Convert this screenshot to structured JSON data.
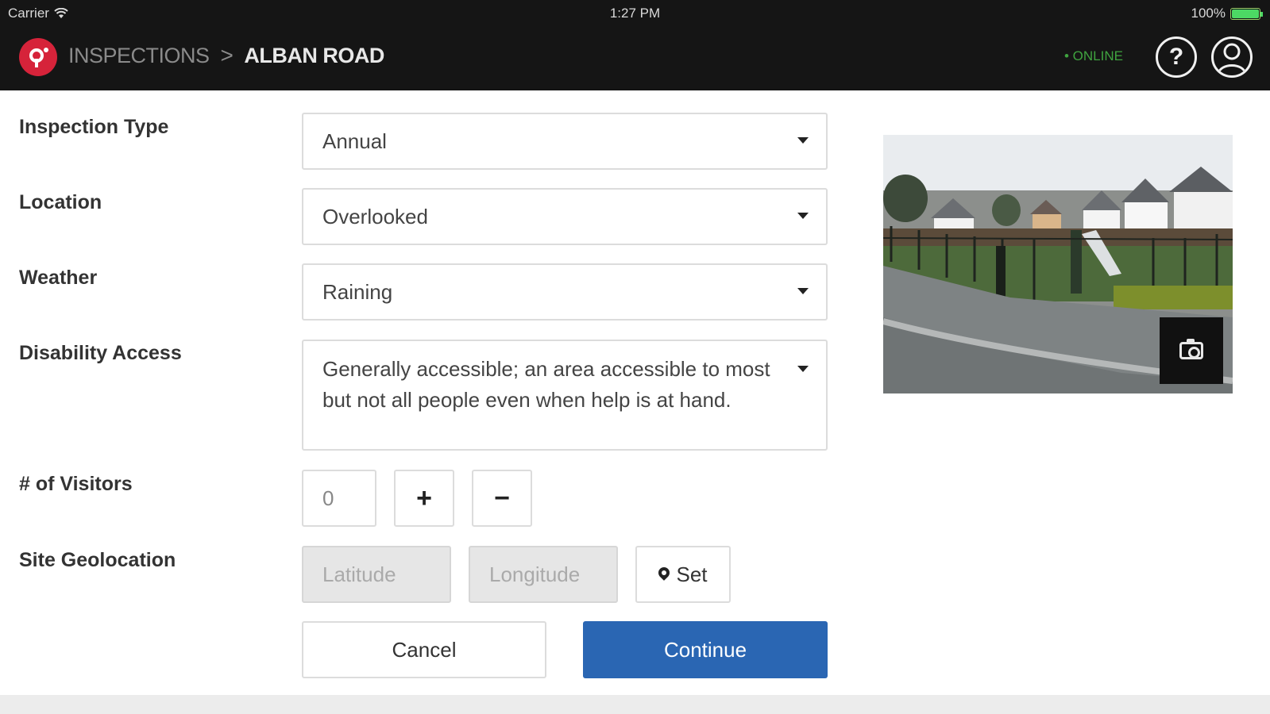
{
  "status_bar": {
    "carrier": "Carrier",
    "time": "1:27 PM",
    "battery": "100%"
  },
  "nav": {
    "breadcrumb_parent": "INSPECTIONS",
    "breadcrumb_sep": ">",
    "breadcrumb_current": "ALBAN ROAD",
    "status": "• ONLINE",
    "help_glyph": "?"
  },
  "form": {
    "inspection_type": {
      "label": "Inspection Type",
      "value": "Annual"
    },
    "location": {
      "label": "Location",
      "value": "Overlooked"
    },
    "weather": {
      "label": "Weather",
      "value": "Raining"
    },
    "disability_access": {
      "label": "Disability Access",
      "value": "Generally accessible; an area accessible to most but not all people even when help is at hand."
    },
    "visitors": {
      "label": "# of Visitors",
      "value": "0",
      "plus": "+",
      "minus": "−"
    },
    "geolocation": {
      "label": "Site Geolocation",
      "latitude_placeholder": "Latitude",
      "longitude_placeholder": "Longitude",
      "set_label": "Set"
    },
    "cancel_label": "Cancel",
    "continue_label": "Continue"
  },
  "colors": {
    "accent": "#2a66b3",
    "brand": "#d6233a",
    "online": "#3fa33f",
    "nav_background": "#151515"
  },
  "icons": [
    "wifi-icon",
    "battery-icon",
    "brand-logo-icon",
    "help-icon",
    "user-icon",
    "caret-down-icon",
    "map-pin-icon",
    "camera-icon"
  ]
}
